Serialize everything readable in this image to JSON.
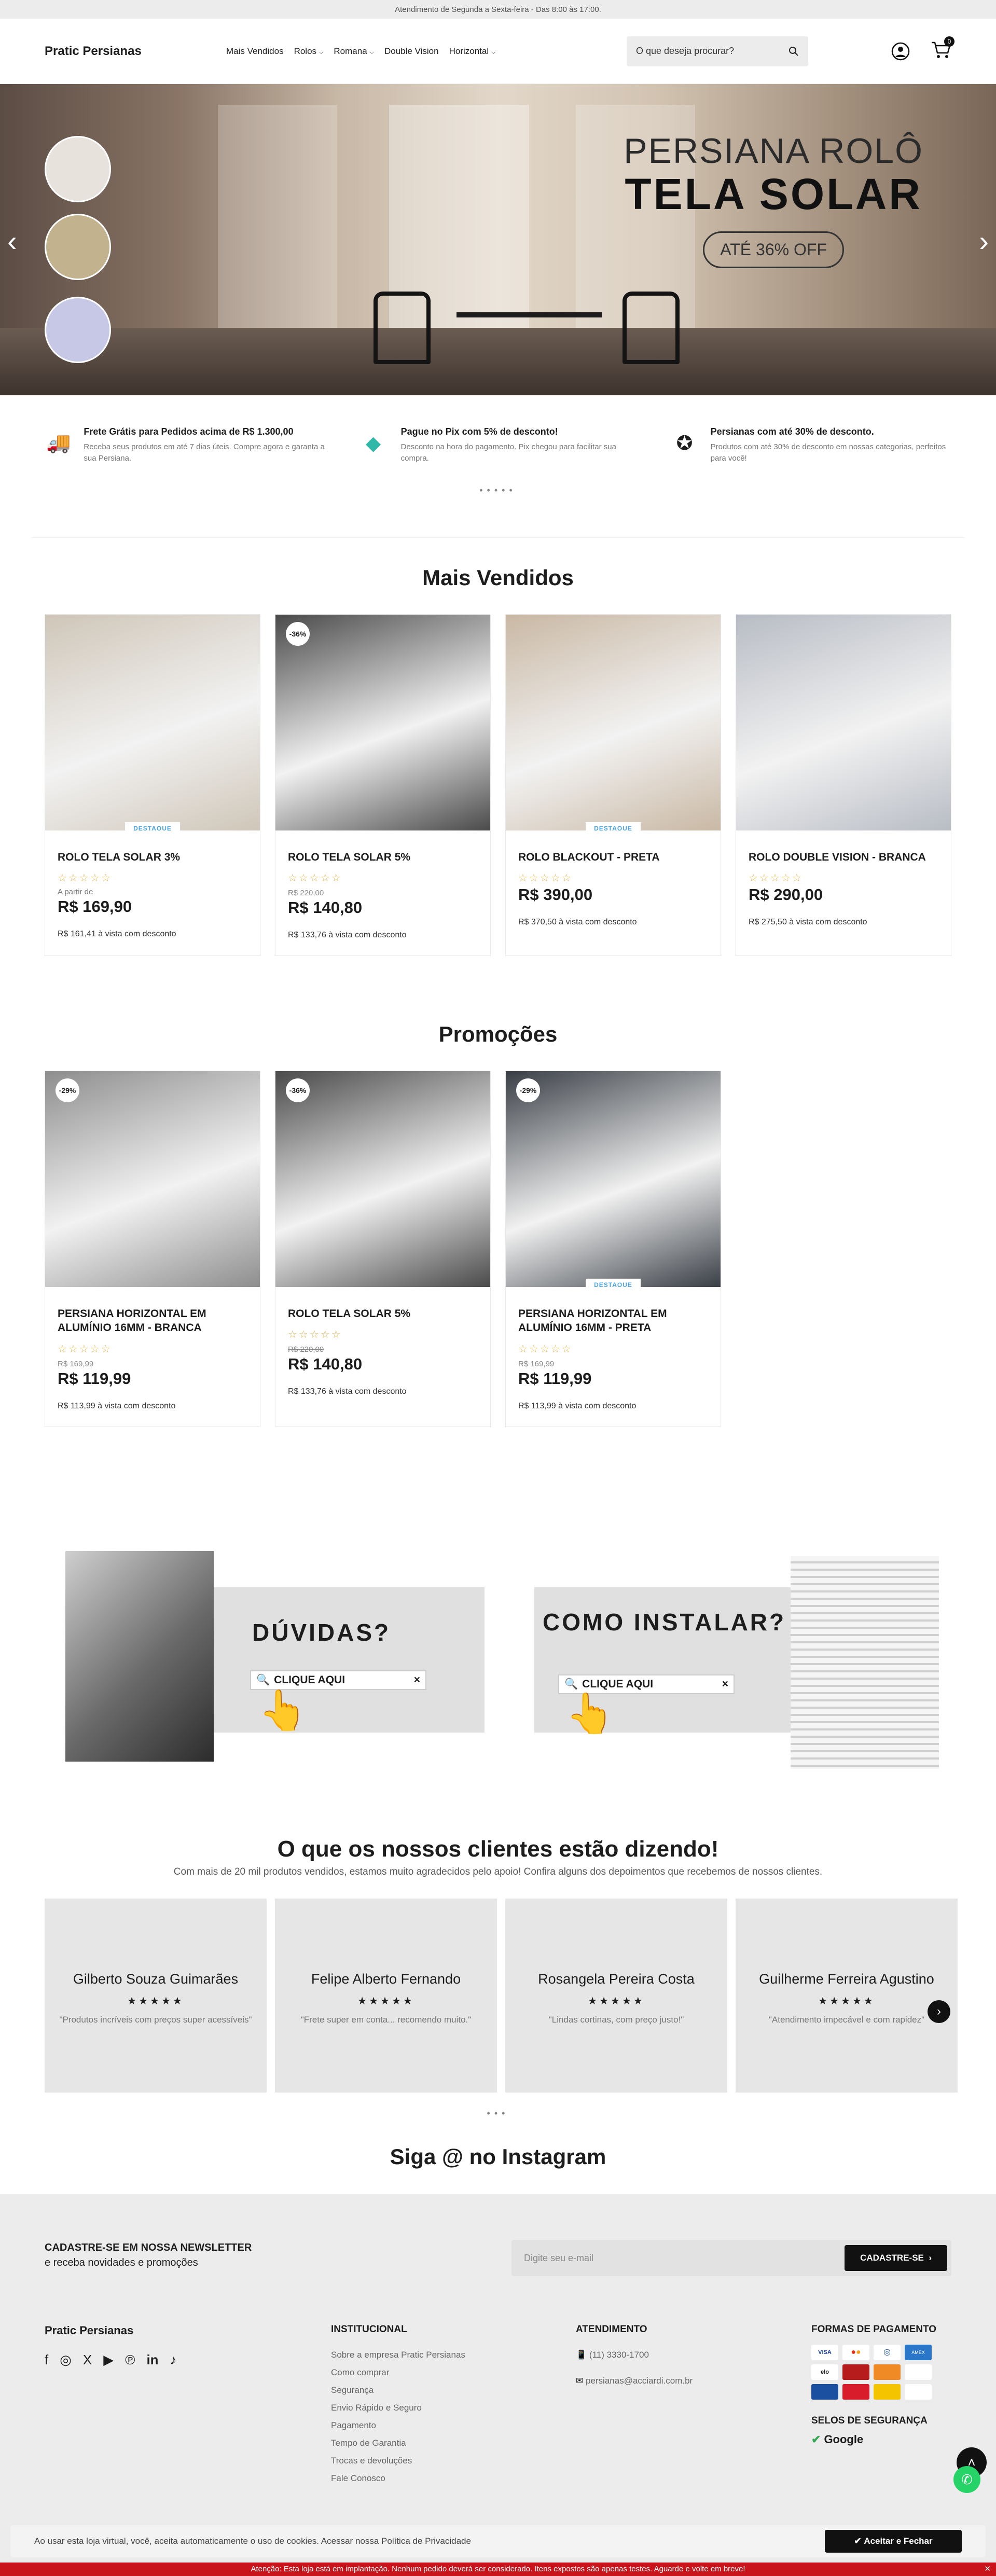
{
  "topbar": {
    "text": "Atendimento de Segunda a Sexta-feira - Das 8:00 às 17:00."
  },
  "header": {
    "logo": "Pratic Persianas",
    "nav": [
      {
        "label": "Mais Vendidos",
        "dropdown": false
      },
      {
        "label": "Rolos",
        "dropdown": true
      },
      {
        "label": "Romana",
        "dropdown": true
      },
      {
        "label": "Double Vision",
        "dropdown": false
      },
      {
        "label": "Horizontal",
        "dropdown": true
      }
    ],
    "search_placeholder": "O que deseja procurar?",
    "cart_count": "0"
  },
  "hero": {
    "line1": "PERSIANA ROLÔ",
    "line2": "TELA SOLAR",
    "badge": "ATÉ 36% OFF"
  },
  "benefits": [
    {
      "icon": "truck-icon",
      "title": "Frete Grátis para Pedidos acima de R$ 1.300,00",
      "text": "Receba seus produtos em até 7 dias úteis. Compre agora e garanta a sua Persiana."
    },
    {
      "icon": "pix-icon",
      "title": "Pague no Pix com 5% de desconto!",
      "text": "Desconto na hora do pagamento. Pix chegou para facilitar sua compra."
    },
    {
      "icon": "discount-icon",
      "title": "Persianas com até 30% de desconto.",
      "text": "Produtos com até 30% de desconto em nossas categorias, perfeitos para você!"
    }
  ],
  "sections": {
    "best_sellers": "Mais Vendidos",
    "promotions": "Promoções",
    "testimonials_title": "O que os nossos clientes estão dizendo!",
    "testimonials_sub": "Com mais de 20 mil produtos vendidos, estamos muito agradecidos pelo apoio! Confira alguns dos depoimentos que recebemos de nossos clientes.",
    "instagram": "Siga @ no Instagram"
  },
  "best_sellers": [
    {
      "name": "ROLO TELA SOLAR 3%",
      "tag": "",
      "badge": "DESTAQUE",
      "prefix": "A partir de",
      "old": "",
      "price": "R$ 169,90",
      "pix": "R$ 161,41 à vista com desconto",
      "color": "#cfc6b8"
    },
    {
      "name": "ROLO TELA SOLAR 5%",
      "tag": "-36%",
      "badge": "",
      "prefix": "",
      "old": "R$ 220,00",
      "price": "R$ 140,80",
      "pix": "R$ 133,76 à vista com desconto",
      "color": "#4a4a4a"
    },
    {
      "name": "ROLO BLACKOUT - PRETA",
      "tag": "",
      "badge": "DESTAQUE",
      "prefix": "",
      "old": "",
      "price": "R$ 390,00",
      "pix": "R$ 370,50 à vista com desconto",
      "color": "#c9b8a4"
    },
    {
      "name": "ROLO DOUBLE VISION - BRANCA",
      "tag": "",
      "badge": "",
      "prefix": "",
      "old": "",
      "price": "R$ 290,00",
      "pix": "R$ 275,50 à vista com desconto",
      "color": "#b8bcc4"
    }
  ],
  "promotions": [
    {
      "name": "PERSIANA HORIZONTAL EM ALUMÍNIO 16MM - BRANCA",
      "tag": "-29%",
      "badge": "",
      "old": "R$ 169,99",
      "price": "R$ 119,99",
      "pix": "R$ 113,99 à vista com desconto",
      "color": "#8e8e8e"
    },
    {
      "name": "ROLO TELA SOLAR 5%",
      "tag": "-36%",
      "badge": "",
      "old": "R$ 220,00",
      "price": "R$ 140,80",
      "pix": "R$ 133,76 à vista com desconto",
      "color": "#4a4a4a"
    },
    {
      "name": "PERSIANA HORIZONTAL EM ALUMÍNIO 16MM - PRETA",
      "tag": "-29%",
      "badge": "DESTAQUE",
      "old": "R$ 169,99",
      "price": "R$ 119,99",
      "pix": "R$ 113,99 à vista com desconto",
      "color": "#3a3f46"
    }
  ],
  "banners": {
    "left_title": "DÚVIDAS?",
    "right_title": "COMO INSTALAR?",
    "cta": "CLIQUE AQUI"
  },
  "reviews": [
    {
      "name": "Gilberto Souza Guimarães",
      "stars": "★★★★★",
      "text": "\"Produtos incríveis com preços super acessíveis\""
    },
    {
      "name": "Felipe Alberto Fernando",
      "stars": "★★★★★",
      "text": "\"Frete super em conta... recomendo muito.\""
    },
    {
      "name": "Rosangela Pereira Costa",
      "stars": "★★★★★",
      "text": "\"Lindas cortinas, com preço justo!\""
    },
    {
      "name": "Guilherme Ferreira Agustino",
      "stars": "★★★★★",
      "text": "\"Atendimento impecável e com rapidez\""
    }
  ],
  "newsletter": {
    "title": "CADASTRE-SE EM NOSSA NEWSLETTER",
    "sub": "e receba novidades e promoções",
    "placeholder": "Digite seu e-mail",
    "button": "CADASTRE-SE"
  },
  "footer": {
    "brand": "Pratic Persianas",
    "institutional_title": "INSTITUCIONAL",
    "institutional": [
      "Sobre a empresa Pratic Persianas",
      "Como comprar",
      "Segurança",
      "Envio Rápido e Seguro",
      "Pagamento",
      "Tempo de Garantia",
      "Trocas e devoluções",
      "Fale Conosco"
    ],
    "service_title": "ATENDIMENTO",
    "phone": "(11) 3330-1700",
    "email": "persianas@acciardi.com.br",
    "payment_title": "FORMAS DE PAGAMENTO",
    "security_title": "SELOS DE SEGURANÇA",
    "security_seal": "Google"
  },
  "cookie": {
    "text": "Ao usar esta loja virtual, você, aceita automaticamente o uso de cookies. Acessar nossa Política de Privacidade",
    "button": "Aceitar e Fechar"
  },
  "bottom_bar": {
    "text": "Atenção: Esta loja está em implantação. Nenhum pedido deverá ser considerado. Itens expostos são apenas testes. Aguarde e volte em breve!"
  },
  "colors": {
    "accent": "#111111",
    "star": "#e2b24b",
    "badge": "#4aa3e0",
    "alert": "#c8141a",
    "whatsapp": "#25d366"
  }
}
